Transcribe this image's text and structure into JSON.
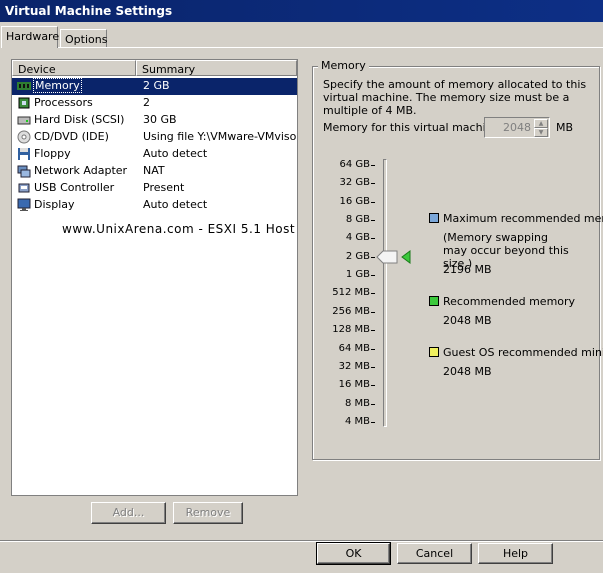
{
  "window": {
    "title": "Virtual Machine Settings"
  },
  "tabs": [
    {
      "label": "Hardware",
      "active": true
    },
    {
      "label": "Options",
      "active": false
    }
  ],
  "device_list": {
    "headers": {
      "device": "Device",
      "summary": "Summary"
    },
    "rows": [
      {
        "device": "Memory",
        "summary": "2 GB",
        "icon": "memory-icon",
        "selected": true
      },
      {
        "device": "Processors",
        "summary": "2",
        "icon": "processor-icon"
      },
      {
        "device": "Hard Disk (SCSI)",
        "summary": "30 GB",
        "icon": "hard-disk-icon"
      },
      {
        "device": "CD/DVD (IDE)",
        "summary": "Using file Y:\\VMware-VMvisor-In",
        "icon": "cd-dvd-icon"
      },
      {
        "device": "Floppy",
        "summary": "Auto detect",
        "icon": "floppy-icon"
      },
      {
        "device": "Network Adapter",
        "summary": "NAT",
        "icon": "network-adapter-icon"
      },
      {
        "device": "USB Controller",
        "summary": "Present",
        "icon": "usb-icon"
      },
      {
        "device": "Display",
        "summary": "Auto detect",
        "icon": "display-icon"
      }
    ]
  },
  "watermark": "www.UnixArena.com - ESXI 5.1 Host",
  "list_buttons": {
    "add": "Add...",
    "remove": "Remove"
  },
  "memory_panel": {
    "group_title": "Memory",
    "description": "Specify the amount of memory allocated to this virtual machine. The memory size must be a multiple of 4 MB.",
    "field_label": "Memory for this virtual machine:",
    "field_value": "2048",
    "unit": "MB",
    "scale_labels": [
      "64 GB",
      "32 GB",
      "16 GB",
      "8 GB",
      "4 GB",
      "2 GB",
      "1 GB",
      "512 MB",
      "256 MB",
      "128 MB",
      "64 MB",
      "32 MB",
      "16 MB",
      "8 MB",
      "4 MB"
    ],
    "slider_value": "2 GB",
    "legend": {
      "max": {
        "label": "Maximum recommended memory",
        "note": "(Memory swapping may occur beyond this size.)",
        "value": "2196 MB",
        "color": "#7ba7d9"
      },
      "recommended": {
        "label": "Recommended memory",
        "value": "2048 MB",
        "color": "#3cc83c"
      },
      "guest": {
        "label": "Guest OS recommended minimum",
        "value": "2048 MB",
        "color": "#f0f060"
      }
    }
  },
  "footer_buttons": {
    "ok": "OK",
    "cancel": "Cancel",
    "help": "Help"
  }
}
